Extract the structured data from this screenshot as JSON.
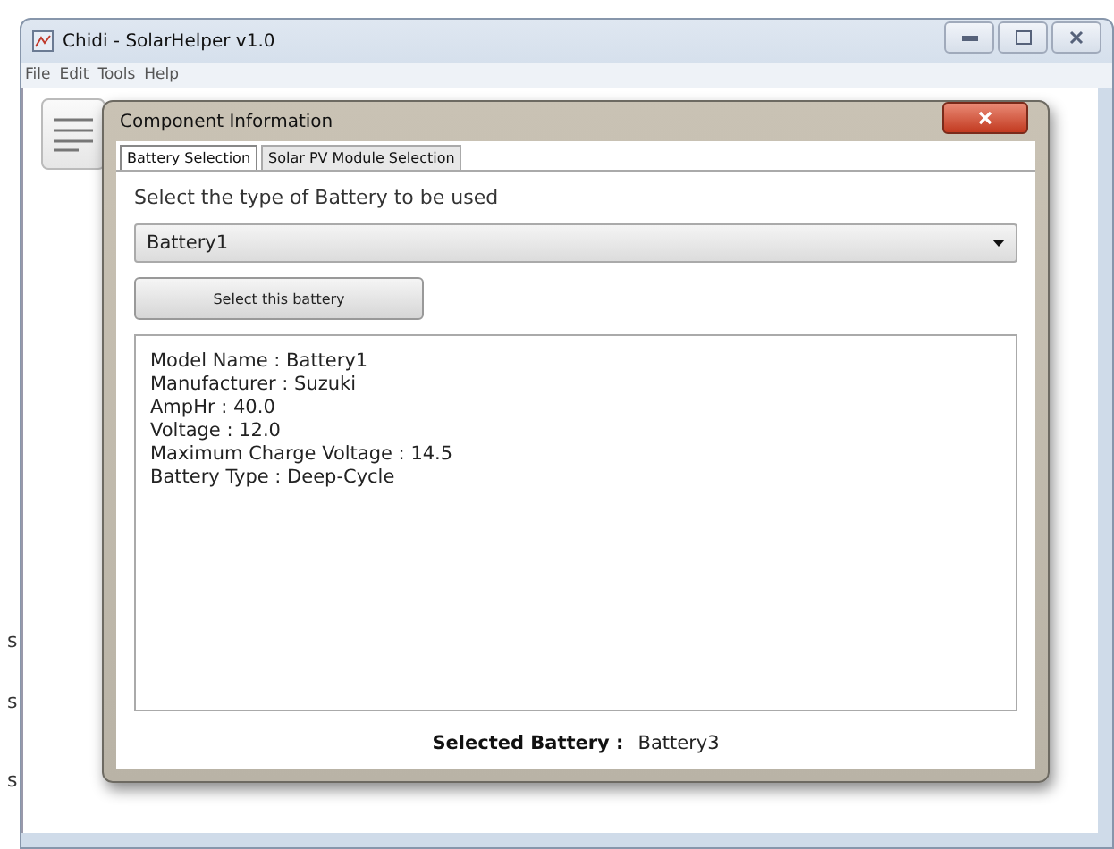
{
  "window": {
    "title": "Chidi - SolarHelper v1.0"
  },
  "menu": [
    "File",
    "Edit",
    "Tools",
    "Help"
  ],
  "side_labels": [
    "s",
    "s",
    "s"
  ],
  "dialog": {
    "title": "Component Information",
    "tabs": [
      {
        "label": "Battery Selection",
        "selected": true
      },
      {
        "label": "Solar PV Module Selection",
        "selected": false
      }
    ],
    "prompt": "Select the type of Battery to be used",
    "dropdown": {
      "value": "Battery1"
    },
    "button": "Select this battery",
    "details": [
      "Model Name : Battery1",
      "Manufacturer : Suzuki",
      "AmpHr : 40.0",
      "Voltage : 12.0",
      "Maximum Charge Voltage : 14.5",
      "Battery Type : Deep-Cycle"
    ],
    "footer": {
      "label": "Selected Battery :",
      "value": "Battery3"
    }
  }
}
